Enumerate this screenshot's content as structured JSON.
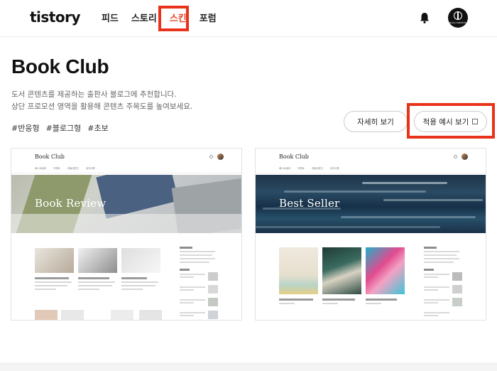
{
  "header": {
    "logo": "tistory",
    "nav": [
      "피드",
      "스토리",
      "스킨",
      "포럼"
    ],
    "active_nav": "스킨",
    "bell_icon": "bell-icon",
    "avatar_label": "BLOG CREATOR"
  },
  "page": {
    "title": "Book Club",
    "desc_line1": "도서 콘텐츠를 제공하는 출판사 블로그에 추천합니다.",
    "desc_line2": "상단 프로모션 영역을 활용해 콘텐츠 주목도를 높여보세요.",
    "tags": [
      "#반응형",
      "#블로그형",
      "#초보"
    ]
  },
  "buttons": {
    "detail": "자세히 보기",
    "preview": "적용 예시 보기"
  },
  "previews": [
    {
      "blog_title": "Book Club",
      "menu": [
        "베스트셀러",
        "이벤트",
        "비밀대표단",
        "공지사항"
      ],
      "hero_text": "Book Review"
    },
    {
      "blog_title": "Book Club",
      "menu": [
        "베스트셀러",
        "이벤트",
        "비밀대표단",
        "공지사항"
      ],
      "hero_text": "Best Seller"
    }
  ],
  "colors": {
    "highlight": "#e8321a",
    "active_nav": "#e6452b"
  }
}
